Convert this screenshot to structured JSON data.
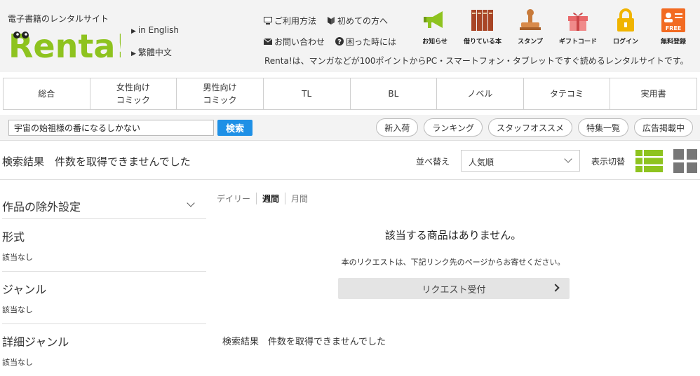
{
  "header": {
    "tagline": "電子書籍のレンタルサイト",
    "logo_text": "Renta!",
    "lang_links": [
      {
        "label": "in English"
      },
      {
        "label": "繁體中文"
      }
    ],
    "help_links": [
      {
        "label": "ご利用方法",
        "icon": "monitor-icon"
      },
      {
        "label": "初めての方へ",
        "icon": "beginner-icon"
      },
      {
        "label": "お問い合わせ",
        "icon": "mail-icon"
      },
      {
        "label": "困った時には",
        "icon": "question-icon"
      }
    ],
    "info_text": "Renta!は、マンガなどが100ポイントからPC・スマートフォン・タブレットですぐ読めるレンタルサイトです。",
    "top_icons": [
      {
        "label": "お知らせ",
        "icon": "megaphone-icon",
        "color": "#8ec31f"
      },
      {
        "label": "借りている本",
        "icon": "bookshelf-icon",
        "color": "#b04a2a"
      },
      {
        "label": "スタンプ",
        "icon": "stamp-icon",
        "color": "#d88a4a"
      },
      {
        "label": "ギフトコード",
        "icon": "gift-icon",
        "color": "#e8686a"
      },
      {
        "label": "ログイン",
        "icon": "lock-icon",
        "color": "#f0b400"
      },
      {
        "label": "無料登録",
        "icon": "free-register-icon",
        "color": "#f26a21",
        "badge": "FREE"
      }
    ]
  },
  "nav": {
    "items": [
      {
        "label": "総合"
      },
      {
        "label": "女性向け\nコミック"
      },
      {
        "label": "男性向け\nコミック"
      },
      {
        "label": "TL"
      },
      {
        "label": "BL"
      },
      {
        "label": "ノベル"
      },
      {
        "label": "タテコミ"
      },
      {
        "label": "実用書"
      }
    ]
  },
  "search": {
    "value": "宇宙の始祖様の番になるしかない",
    "button_label": "検索",
    "pills": [
      {
        "label": "新入荷"
      },
      {
        "label": "ランキング"
      },
      {
        "label": "スタッフオススメ"
      },
      {
        "label": "特集一覧"
      },
      {
        "label": "広告掲載中"
      }
    ]
  },
  "results": {
    "heading": "検索結果　件数を取得できませんでした",
    "sort_label": "並べ替え",
    "sort_value": "人気順",
    "view_label": "表示切替",
    "list_view_color": "#8ec31f",
    "grid_view_color": "#777777"
  },
  "sidebar": {
    "exclude_label": "作品の除外設定",
    "sections": [
      {
        "title": "形式",
        "value": "該当なし"
      },
      {
        "title": "ジャンル",
        "value": "該当なし"
      },
      {
        "title": "詳細ジャンル",
        "value": "該当なし"
      }
    ]
  },
  "main": {
    "periods": [
      {
        "label": "デイリー",
        "active": false
      },
      {
        "label": "週間",
        "active": true
      },
      {
        "label": "月間",
        "active": false
      }
    ],
    "no_result": "該当する商品はありません。",
    "request_text": "本のリクエストは、下記リンク先のページからお寄せください。",
    "request_button": "リクエスト受付",
    "footer_heading": "検索結果　件数を取得できませんでした"
  }
}
